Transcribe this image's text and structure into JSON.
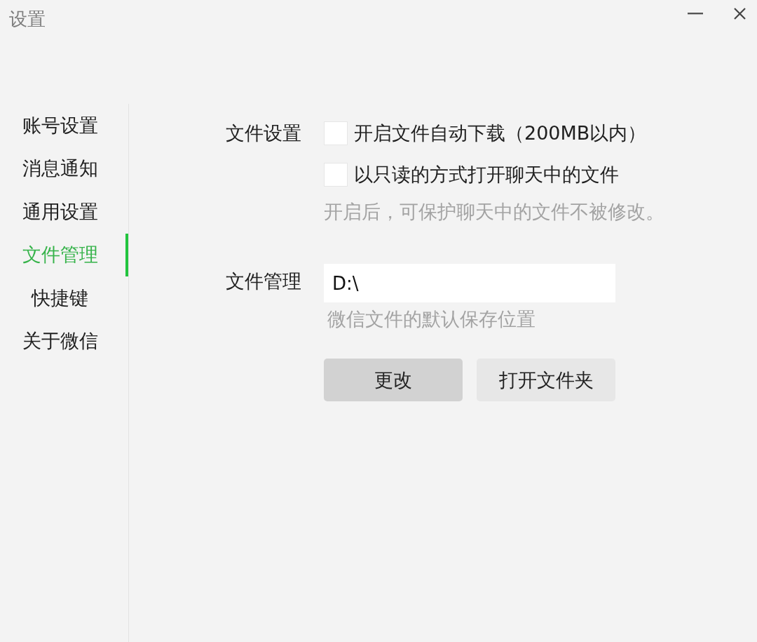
{
  "window": {
    "title": "设置"
  },
  "sidebar": {
    "items": [
      {
        "label": "账号设置",
        "selected": false
      },
      {
        "label": "消息通知",
        "selected": false
      },
      {
        "label": "通用设置",
        "selected": false
      },
      {
        "label": "文件管理",
        "selected": true
      },
      {
        "label": "快捷键",
        "selected": false
      },
      {
        "label": "关于微信",
        "selected": false
      }
    ]
  },
  "file_settings": {
    "label": "文件设置",
    "options": [
      {
        "label": "开启文件自动下载（200MB以内）",
        "checked": false
      },
      {
        "label": "以只读的方式打开聊天中的文件",
        "checked": false
      }
    ],
    "hint": "开启后，可保护聊天中的文件不被修改。"
  },
  "file_management": {
    "label": "文件管理",
    "path_field": {
      "value": "D:\\"
    },
    "hint": "微信文件的默认保存位置",
    "buttons": [
      {
        "label": "更改",
        "kind": "primary"
      },
      {
        "label": "打开文件夹",
        "kind": "secondary"
      }
    ]
  }
}
